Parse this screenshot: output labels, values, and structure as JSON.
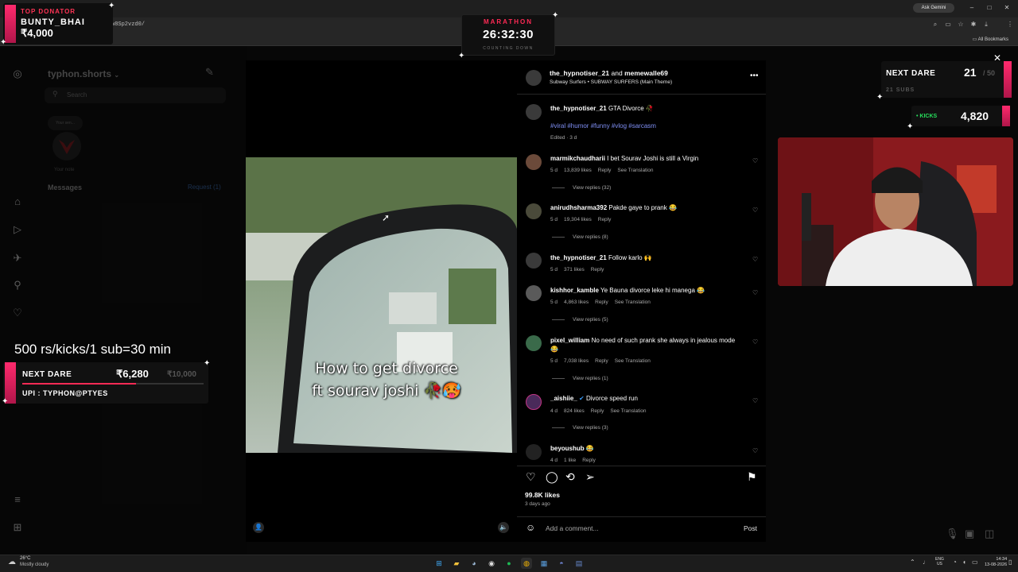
{
  "browser": {
    "url_fragment": "w8Sp2vzd0/",
    "ask_gemini": "Ask Gemini",
    "all_bookmarks": "All Bookmarks",
    "window_controls": [
      "–",
      "□",
      "✕"
    ]
  },
  "instagram_left": {
    "username": "typhon.shorts",
    "search_placeholder": "Search",
    "note_bubble": "Your sen...",
    "note_label": "Your note",
    "messages_label": "Messages",
    "request_label": "Request (1)",
    "nav_icons": [
      "instagram-icon",
      "home-icon",
      "reels-icon",
      "messenger-icon",
      "search-icon",
      "heart-icon",
      "menu-icon",
      "apps-icon"
    ]
  },
  "overlays": {
    "top_donator": {
      "title": "TOP DONATOR",
      "name": "BUNTY_BHAI",
      "amount": "₹4,000"
    },
    "marathon": {
      "title": "MARATHON",
      "time": "26:32:30",
      "subtitle": "COUNTING DOWN"
    },
    "next_dare_top": {
      "label": "NEXT DARE",
      "count": "21",
      "goal": "/ 50",
      "subs": "21 SUBS"
    },
    "kicks": {
      "label": "• KICKS",
      "value": "4,820"
    },
    "rate_text": "500 rs/kicks/1 sub=30 min",
    "next_dare_bottom": {
      "label": "NEXT DARE",
      "amount": "₹6,280",
      "goal": "₹10,000",
      "progress": 0.628,
      "upi": "UPI : TYPHON@PTYES"
    }
  },
  "post": {
    "caption_line1": "How to get divorce",
    "caption_line2": "ft sourav joshi 🥀🥵",
    "header_user1": "the_hypnotiser_21",
    "header_and": "and",
    "header_user2": "memewalle69",
    "audio": "Subway Surfers • SUBWAY SURFERS (Main Theme)",
    "author_caption_user": "the_hypnotiser_21",
    "author_caption_text": "GTA Divorce 🥀",
    "hashtags": "#viral #humor #funny #vlog #sarcasm",
    "edited": "Edited · 3 d",
    "likes": "99.8K likes",
    "posted_ago": "3 days ago",
    "add_comment_placeholder": "Add a comment...",
    "post_label": "Post"
  },
  "comments": [
    {
      "user": "marmikchaudharii",
      "text": "I bet Sourav Joshi is still a Virgin",
      "age": "5 d",
      "likes": "13,839 likes",
      "reply": "Reply",
      "translation": "See Translation",
      "replies": "View replies (32)"
    },
    {
      "user": "anirudhsharma392",
      "text": "Pakde gaye to prank 😂",
      "age": "5 d",
      "likes": "19,304 likes",
      "reply": "Reply",
      "translation": "",
      "replies": "View replies (8)"
    },
    {
      "user": "the_hypnotiser_21",
      "text": "Follow karlo 🙌",
      "age": "5 d",
      "likes": "371 likes",
      "reply": "Reply",
      "translation": "",
      "replies": ""
    },
    {
      "user": "kishhor_kamble",
      "text": "Ye Bauna divorce leke hi manega 😂",
      "age": "5 d",
      "likes": "4,863 likes",
      "reply": "Reply",
      "translation": "See Translation",
      "replies": "View replies (5)"
    },
    {
      "user": "pixel_william",
      "text": "No need of such prank she always in jealous mode😂",
      "age": "5 d",
      "likes": "7,038 likes",
      "reply": "Reply",
      "translation": "See Translation",
      "replies": "View replies (1)"
    },
    {
      "user": "_aishiie_",
      "text": "Divorce speed run",
      "age": "4 d",
      "likes": "824 likes",
      "reply": "Reply",
      "translation": "See Translation",
      "replies": "View replies (3)"
    },
    {
      "user": "beyoushub",
      "text": "😂",
      "age": "4 d",
      "likes": "1 like",
      "reply": "Reply",
      "translation": "",
      "replies": ""
    }
  ],
  "taskbar": {
    "temp": "26°C",
    "weather": "Mostly cloudy",
    "lang1": "ENG",
    "lang2": "US",
    "time": "14:34",
    "date": "13-08-2026"
  }
}
